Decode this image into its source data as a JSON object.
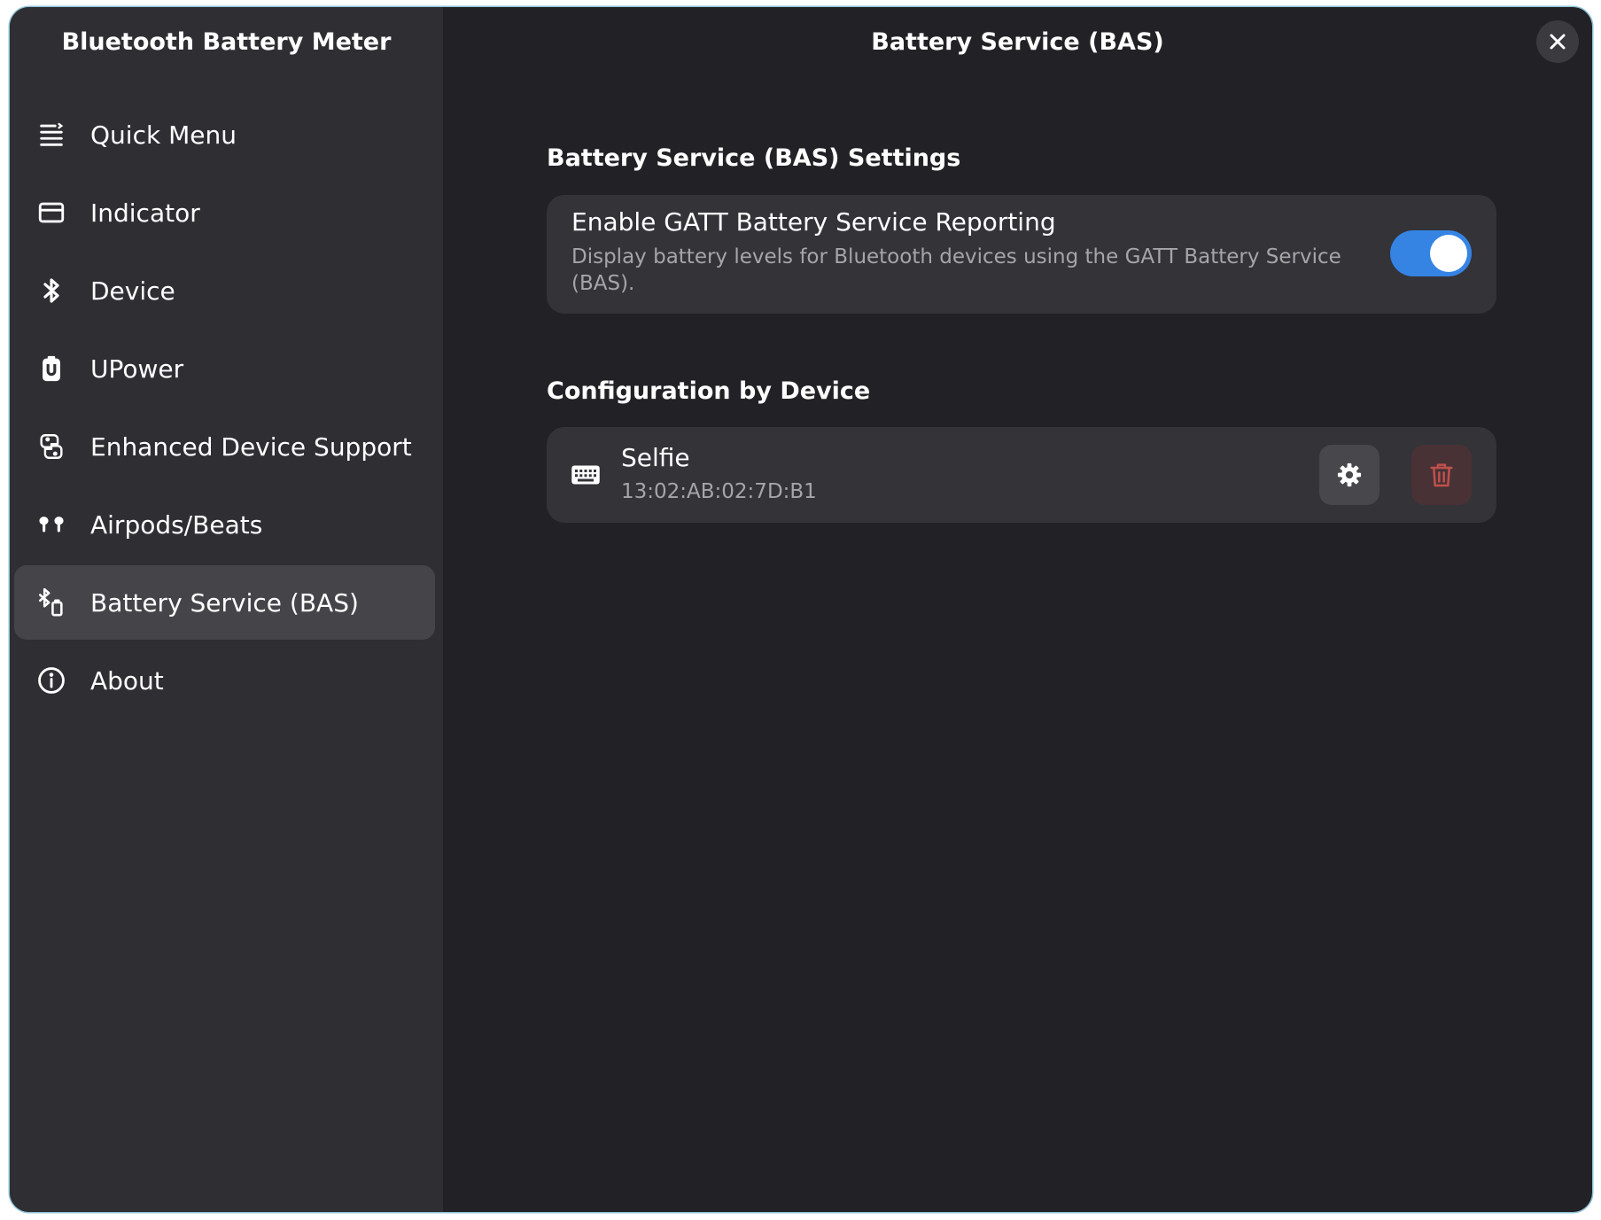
{
  "sidebar": {
    "title": "Bluetooth Battery Meter",
    "items": [
      {
        "label": "Quick Menu",
        "icon": "quick-menu-icon",
        "active": false
      },
      {
        "label": "Indicator",
        "icon": "indicator-icon",
        "active": false
      },
      {
        "label": "Device",
        "icon": "bluetooth-icon",
        "active": false
      },
      {
        "label": "UPower",
        "icon": "upower-icon",
        "active": false
      },
      {
        "label": "Enhanced Device Support",
        "icon": "enhanced-device-icon",
        "active": false
      },
      {
        "label": "Airpods/Beats",
        "icon": "airpods-icon",
        "active": false
      },
      {
        "label": "Battery Service (BAS)",
        "icon": "bluetooth-battery-icon",
        "active": true
      },
      {
        "label": "About",
        "icon": "info-icon",
        "active": false
      }
    ]
  },
  "header": {
    "title": "Battery Service (BAS)",
    "close_icon": "close-icon"
  },
  "settings_section": {
    "heading": "Battery Service (BAS) Settings",
    "row": {
      "title": "Enable GATT Battery Service Reporting",
      "subtitle": "Display battery levels for Bluetooth devices using the GATT Battery Service (BAS).",
      "toggle_on": true
    }
  },
  "devices_section": {
    "heading": "Configuration by Device",
    "devices": [
      {
        "name": "Selfie",
        "address": "13:02:AB:02:7D:B1",
        "icon": "keyboard-icon"
      }
    ]
  },
  "colors": {
    "accent": "#3584e4",
    "sidebar_bg": "#2e2e33",
    "content_bg": "#222226",
    "card_bg": "#333338",
    "destructive": "#c0504d"
  }
}
